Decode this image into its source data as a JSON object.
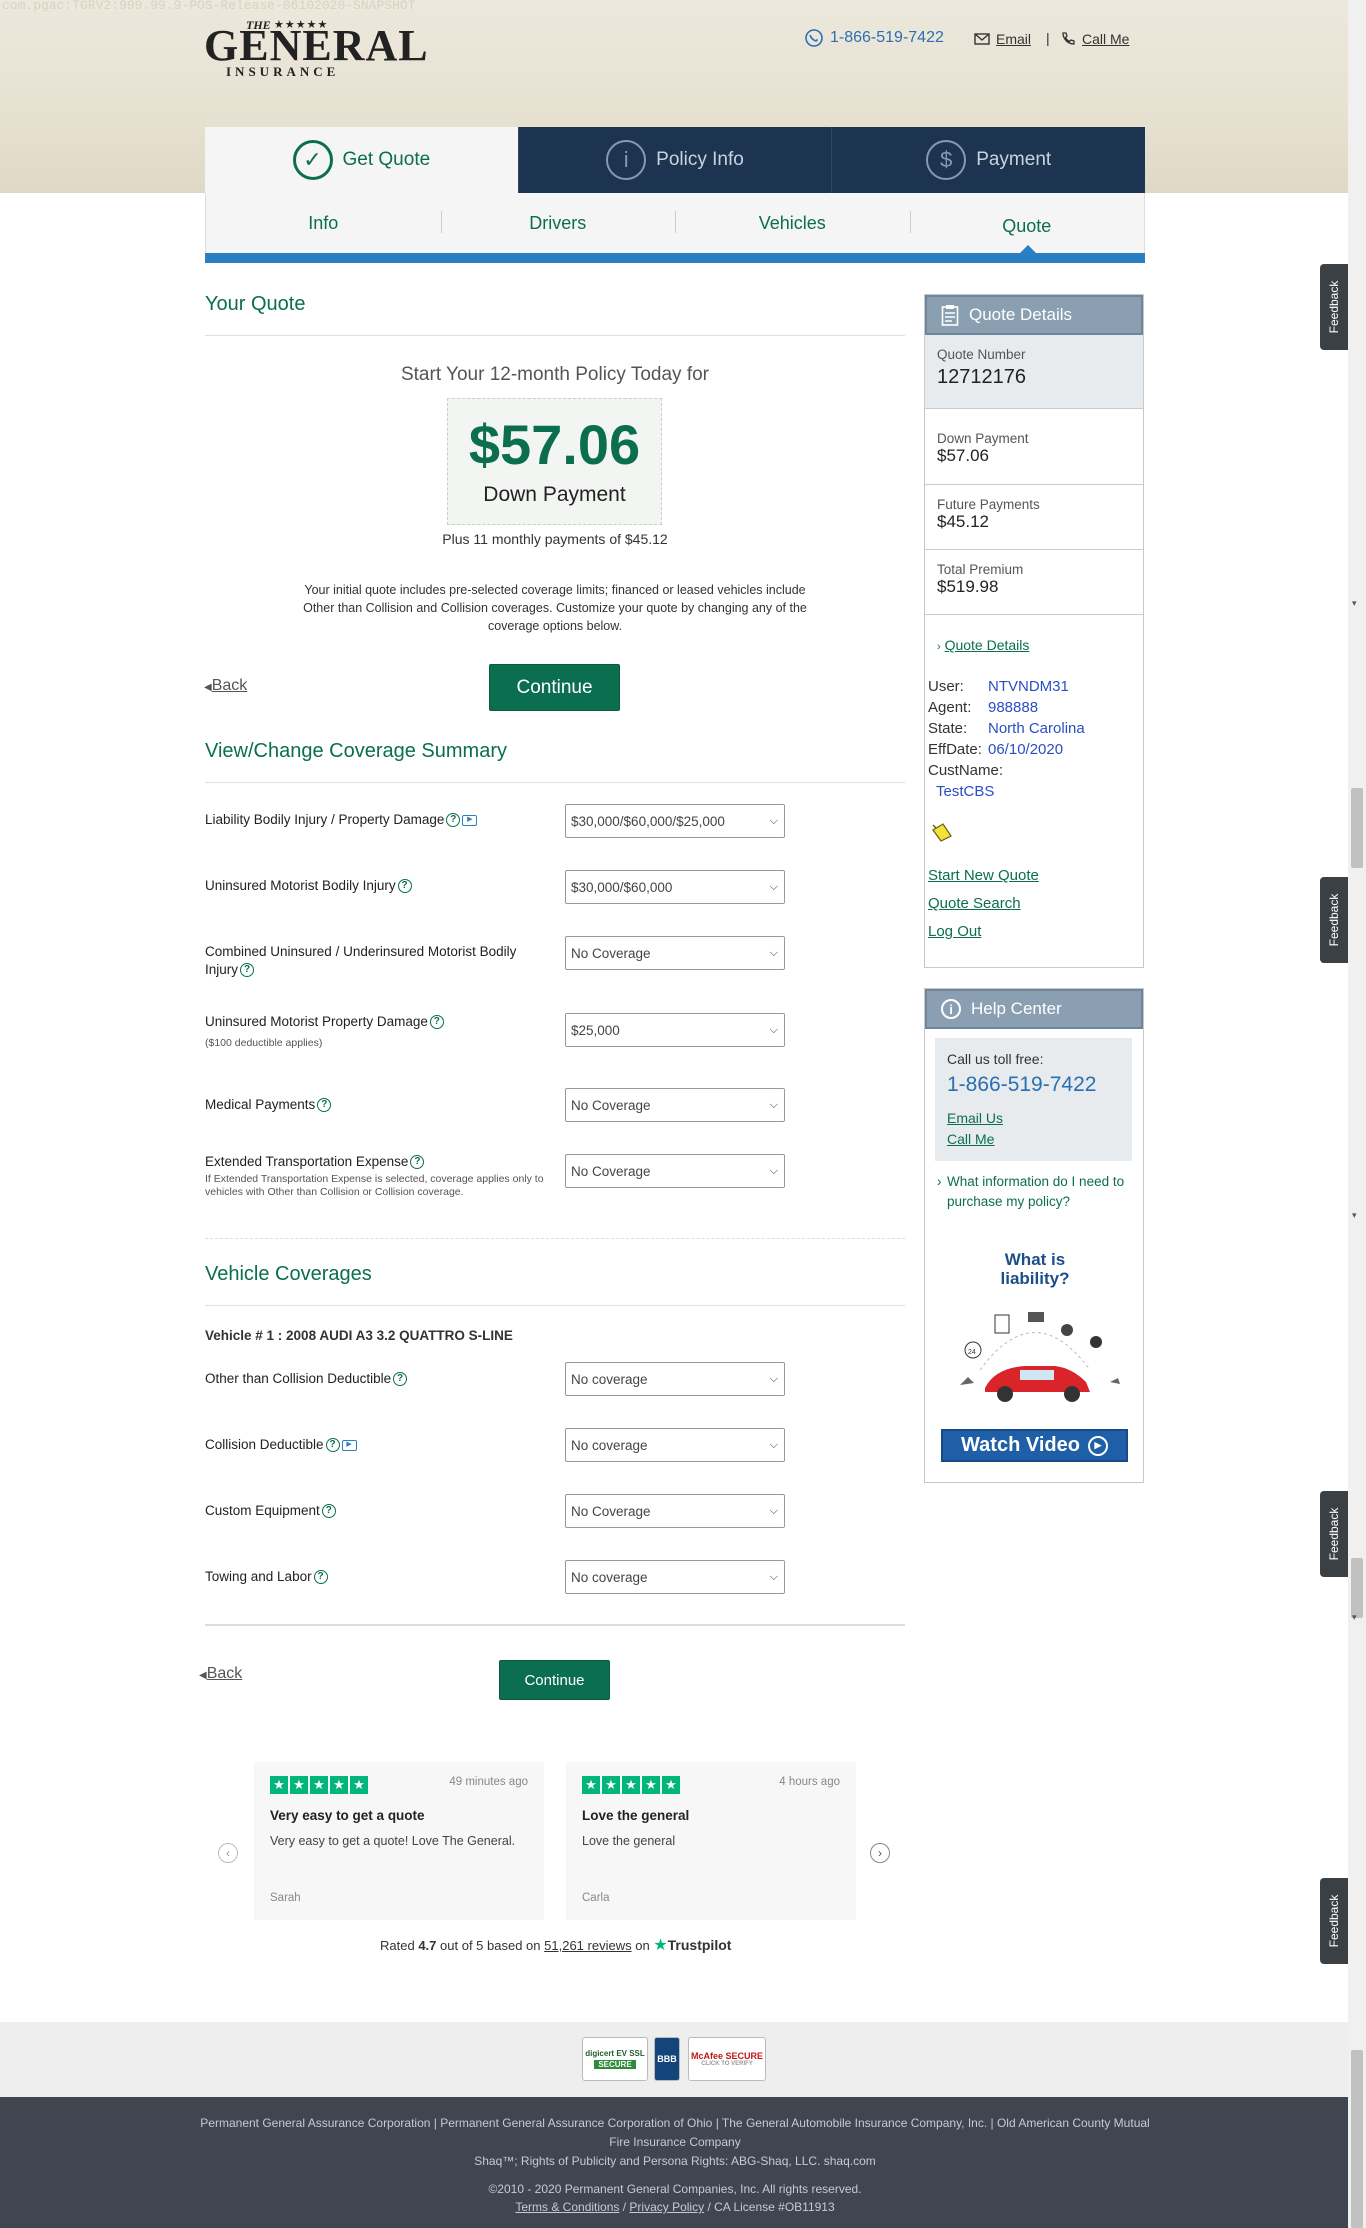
{
  "build_string": "com.pgac:TGRV2:999.99.9-POS-Release-06102020-SNAPSHOT",
  "logo": {
    "the": "THE",
    "stars": "★★★★★",
    "name": "GENERAL",
    "sub": "INSURANCE"
  },
  "header": {
    "phone": "1-866-519-7422",
    "email": "Email",
    "separator": "|",
    "call_me": "Call Me"
  },
  "main_tabs": [
    {
      "label": "Get Quote",
      "icon": "check-icon",
      "glyph": "✓"
    },
    {
      "label": "Policy Info",
      "icon": "info-icon",
      "glyph": "i"
    },
    {
      "label": "Payment",
      "icon": "dollar-icon",
      "glyph": "$"
    }
  ],
  "sub_tabs": [
    {
      "label": "Info"
    },
    {
      "label": "Drivers"
    },
    {
      "label": "Vehicles"
    },
    {
      "label": "Quote"
    }
  ],
  "quote": {
    "section_title": "Your Quote",
    "start_text": "Start Your 12-month Policy Today for",
    "amount": "$57.06",
    "amount_label": "Down Payment",
    "plus_text": "Plus 11 monthly payments of $45.12",
    "initial_text": "Your initial quote includes pre-selected coverage limits; financed or leased vehicles include Other than Collision and Collision coverages. Customize your quote by changing any of the coverage options below.",
    "back": "Back",
    "continue": "Continue"
  },
  "coverage": {
    "title": "View/Change Coverage Summary",
    "items": [
      {
        "label": "Liability Bodily Injury / Property Damage",
        "value": "$30,000/$60,000/$25,000"
      },
      {
        "label": "Uninsured Motorist Bodily Injury",
        "value": "$30,000/$60,000"
      },
      {
        "label": "Combined Uninsured / Underinsured Motorist Bodily Injury",
        "value": "No Coverage"
      },
      {
        "label": "Uninsured Motorist Property Damage",
        "sub": "($100 deductible applies)",
        "value": "$25,000"
      },
      {
        "label": "Medical Payments",
        "value": "No Coverage"
      },
      {
        "label": "Extended Transportation Expense",
        "sub": "If Extended Transportation Expense is selected, coverage applies only to vehicles with Other than Collision or Collision coverage.",
        "value": "No Coverage"
      }
    ]
  },
  "vehicle_cov": {
    "title": "Vehicle Coverages",
    "vehicle": "Vehicle # 1 : 2008 AUDI A3 3.2 QUATTRO S-LINE",
    "items": [
      {
        "label": "Other than Collision Deductible",
        "value": "No coverage"
      },
      {
        "label": "Collision Deductible",
        "value": "No coverage"
      },
      {
        "label": "Custom Equipment",
        "value": "No Coverage"
      },
      {
        "label": "Towing and Labor",
        "value": "No coverage"
      }
    ],
    "back": "Back",
    "continue": "Continue"
  },
  "quote_details": {
    "title": "Quote Details",
    "quote_number_label": "Quote Number",
    "quote_number": "12712176",
    "down_payment_label": "Down Payment",
    "down_payment": "$57.06",
    "future_label": "Future Payments",
    "future": "$45.12",
    "total_label": "Total Premium",
    "total": "$519.98",
    "details_link": "Quote Details",
    "user_k": "User:",
    "user": "NTVNDM31",
    "agent_k": "Agent:",
    "agent": "988888",
    "state_k": "State:",
    "state": "North Carolina",
    "eff_k": "EffDate:",
    "eff": "06/10/2020",
    "cust_k": "CustName:",
    "cust": "TestCBS",
    "links": [
      "Start New Quote",
      "Quote Search",
      "Log Out"
    ]
  },
  "help": {
    "title": "Help Center",
    "call_label": "Call us toll free:",
    "phone": "1-866-519-7422",
    "email_us": "Email Us",
    "call_me": "Call Me",
    "info_link": "What information do I need to purchase my policy?",
    "liability_title": "What is liability?",
    "watch": "Watch Video"
  },
  "feedback_label": "Feedback",
  "reviews": {
    "items": [
      {
        "time": "49 minutes ago",
        "title": "Very easy to get a quote",
        "body": "Very easy to get a quote! Love The General.",
        "name": "Sarah"
      },
      {
        "time": "4 hours ago",
        "title": "Love the general",
        "body": "Love the general",
        "name": "Carla"
      }
    ],
    "rated_pre": "Rated",
    "rating": "4.7",
    "rated_mid": "out of 5 based on",
    "count": "51,261 reviews",
    "on": "on",
    "brand": "Trustpilot"
  },
  "badges": {
    "digicert": "digicert EV SSL",
    "secure": "SECURE",
    "bbb": "BBB",
    "mcafee": "McAfee SECURE",
    "mcafee_sub": "CLICK TO VERIFY"
  },
  "footer": {
    "companies": "Permanent General Assurance Corporation | Permanent General Assurance Corporation of Ohio | The General Automobile Insurance Company, Inc. | Old American County Mutual Fire Insurance Company",
    "shaq": "Shaq™; Rights of Publicity and Persona Rights: ABG-Shaq, LLC. shaq.com",
    "copyright": "©2010 - 2020 Permanent General Companies, Inc. All rights reserved.",
    "terms": "Terms & Conditions",
    "privacy": "Privacy Policy",
    "license": "/ CA License #OB11913"
  },
  "colors": {
    "brand_green": "#0b6e4f",
    "nav_dark": "#1c3450",
    "accent_blue": "#2a7fc4",
    "panel_head": "#8a9fb2"
  }
}
